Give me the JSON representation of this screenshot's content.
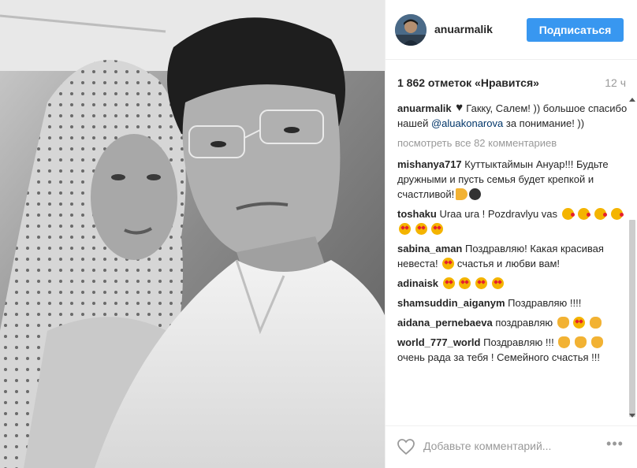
{
  "post": {
    "username": "anuarmalik",
    "follow_label": "Подписаться",
    "likes_text": "1 862 отметок «Нравится»",
    "time_ago": "12 ч",
    "caption_text": "Гакку, Салем! )) большое спасибо нашей",
    "caption_mention": "@aluakonarova",
    "caption_tail": "за понимание! ))",
    "view_all_label": "посмотреть все 82 комментариев"
  },
  "comments": [
    {
      "user": "mishanya717",
      "text": "Куттыктаймын Ануар!!! Будьте дружными и пусть семья будет крепкой и счастливой!"
    },
    {
      "user": "toshaku",
      "text": "Uraa ura ! Pozdravlyu vas"
    },
    {
      "user": "sabina_aman",
      "text": "Поздравляю! Какая красивая невеста!",
      "text2": "счастья и любви вам!"
    },
    {
      "user": "adinaisk",
      "text": ""
    },
    {
      "user": "shamsuddin_aiganym",
      "text": "Поздравляю !!!!"
    },
    {
      "user": "aidana_pernebaeva",
      "text": "поздравляю"
    },
    {
      "user": "world_777_world",
      "text": "Поздравляю !!!",
      "text2": "очень рада за тебя ! Семейного счастья !!!"
    }
  ],
  "footer": {
    "comment_placeholder": "Добавьте комментарий...",
    "more_label": "•••"
  },
  "colors": {
    "follow_button": "#3897f0",
    "mention": "#003569",
    "muted": "#999999"
  },
  "icons": {
    "like": "heart-outline-icon",
    "scroll_up": "scroll-up-arrow-icon",
    "scroll_down": "scroll-down-arrow-icon"
  }
}
